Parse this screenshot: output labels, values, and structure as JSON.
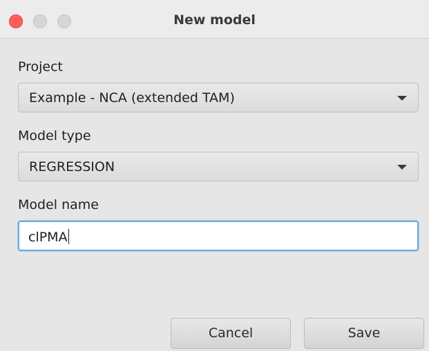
{
  "window": {
    "title": "New model"
  },
  "form": {
    "project": {
      "label": "Project",
      "value": "Example - NCA (extended TAM)"
    },
    "model_type": {
      "label": "Model type",
      "value": "REGRESSION"
    },
    "model_name": {
      "label": "Model name",
      "value": "clPMA"
    }
  },
  "buttons": {
    "cancel_label": "Cancel",
    "save_label": "Save"
  },
  "colors": {
    "close": "#ff5f57",
    "focus_border": "#6fa9d8",
    "background": "#e6e6e6"
  }
}
